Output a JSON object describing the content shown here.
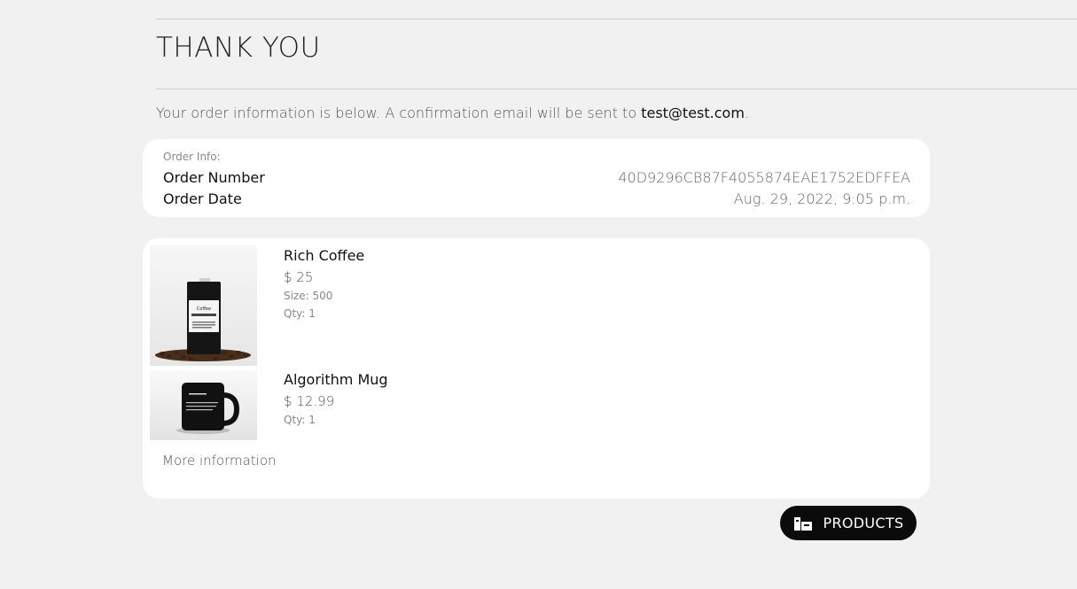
{
  "header": {
    "title": "THANK YOU"
  },
  "intro": {
    "text": "Your order information is below. A confirmation email will be sent to ",
    "email": "test@test.com",
    "suffix": "."
  },
  "order_info": {
    "label": "Order Info:",
    "rows": [
      {
        "key": "Order Number",
        "value": "40D9296CB87F4055874EAE1752EDFFEA"
      },
      {
        "key": "Order Date",
        "value": "Aug. 29, 2022, 9:05 p.m."
      }
    ]
  },
  "items": [
    {
      "name": "Rich Coffee",
      "price": "$ 25",
      "size": "Size: 500",
      "qty": "Qty: 1",
      "image_icon": "coffee-bag-icon",
      "label_text": "Coffee"
    },
    {
      "name": "Algorithm Mug",
      "price": "$ 12.99",
      "qty": "Qty: 1",
      "image_icon": "mug-icon"
    }
  ],
  "more_info_label": "More information",
  "products_button": {
    "label": "PRODUCTS",
    "icon": "boxes-icon"
  },
  "colors": {
    "background": "#f1f1f1",
    "card": "#ffffff",
    "button": "#0b0b0b"
  }
}
